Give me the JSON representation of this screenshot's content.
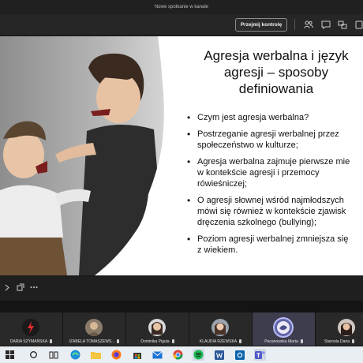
{
  "window": {
    "title": "Nowe spotkanie w kanale"
  },
  "toolbar": {
    "takeover_label": "Przejmij kontrolę"
  },
  "slide": {
    "title": "Agresja werbalna i język agresji – sposoby definiowania",
    "bullets": [
      "Czym jest agresja werbalna?",
      "Postrzeganie agresji werbalnej przez\nspołeczeństwo w kulturze;",
      "Agresja werbalna zajmuje pierwsze mie\nw kontekście agresji i przemocy\nrówieśniczej;",
      "O agresji słownej wśród najmłodszych\nmówi się również w kontekście zjawisk\ndręczenia szkolnego (bullying);",
      "Poziom agresji werbalnej zmniejsza się\nz wiekiem."
    ]
  },
  "participants": [
    {
      "name": "DARIA SZYMAŃSKA",
      "avatar": "lightning-icon",
      "active": false
    },
    {
      "name": "IZABELA TOMASZEWS...",
      "avatar": "photo",
      "active": false
    },
    {
      "name": "Dominika Pigula",
      "avatar": "photo",
      "active": false
    },
    {
      "name": "KLAUDIA RZEWSKA",
      "avatar": "photo",
      "active": false
    },
    {
      "name": "Pacanowska Marta",
      "avatar": "photo",
      "active": true
    },
    {
      "name": "Starosta Daria",
      "avatar": "photo",
      "active": false
    }
  ],
  "colors": {
    "accent": "#6264a7",
    "background": "#1f1f1f",
    "taskbar": "#e9eef3"
  }
}
